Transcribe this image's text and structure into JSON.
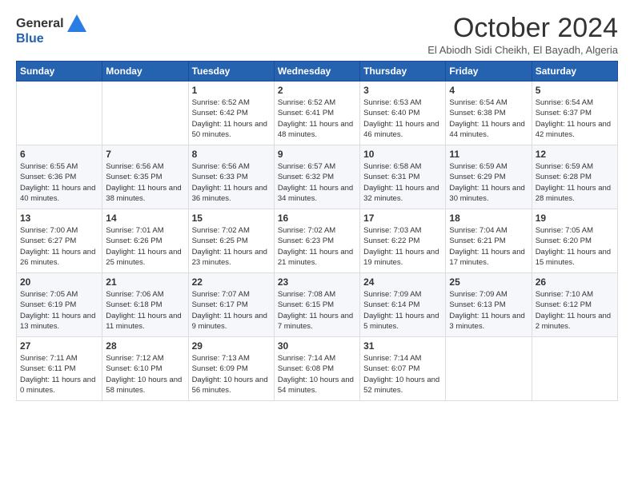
{
  "logo": {
    "general": "General",
    "blue": "Blue"
  },
  "title": "October 2024",
  "subtitle": "El Abiodh Sidi Cheikh, El Bayadh, Algeria",
  "days_of_week": [
    "Sunday",
    "Monday",
    "Tuesday",
    "Wednesday",
    "Thursday",
    "Friday",
    "Saturday"
  ],
  "weeks": [
    [
      {
        "day": "",
        "info": ""
      },
      {
        "day": "",
        "info": ""
      },
      {
        "day": "1",
        "info": "Sunrise: 6:52 AM\nSunset: 6:42 PM\nDaylight: 11 hours and 50 minutes."
      },
      {
        "day": "2",
        "info": "Sunrise: 6:52 AM\nSunset: 6:41 PM\nDaylight: 11 hours and 48 minutes."
      },
      {
        "day": "3",
        "info": "Sunrise: 6:53 AM\nSunset: 6:40 PM\nDaylight: 11 hours and 46 minutes."
      },
      {
        "day": "4",
        "info": "Sunrise: 6:54 AM\nSunset: 6:38 PM\nDaylight: 11 hours and 44 minutes."
      },
      {
        "day": "5",
        "info": "Sunrise: 6:54 AM\nSunset: 6:37 PM\nDaylight: 11 hours and 42 minutes."
      }
    ],
    [
      {
        "day": "6",
        "info": "Sunrise: 6:55 AM\nSunset: 6:36 PM\nDaylight: 11 hours and 40 minutes."
      },
      {
        "day": "7",
        "info": "Sunrise: 6:56 AM\nSunset: 6:35 PM\nDaylight: 11 hours and 38 minutes."
      },
      {
        "day": "8",
        "info": "Sunrise: 6:56 AM\nSunset: 6:33 PM\nDaylight: 11 hours and 36 minutes."
      },
      {
        "day": "9",
        "info": "Sunrise: 6:57 AM\nSunset: 6:32 PM\nDaylight: 11 hours and 34 minutes."
      },
      {
        "day": "10",
        "info": "Sunrise: 6:58 AM\nSunset: 6:31 PM\nDaylight: 11 hours and 32 minutes."
      },
      {
        "day": "11",
        "info": "Sunrise: 6:59 AM\nSunset: 6:29 PM\nDaylight: 11 hours and 30 minutes."
      },
      {
        "day": "12",
        "info": "Sunrise: 6:59 AM\nSunset: 6:28 PM\nDaylight: 11 hours and 28 minutes."
      }
    ],
    [
      {
        "day": "13",
        "info": "Sunrise: 7:00 AM\nSunset: 6:27 PM\nDaylight: 11 hours and 26 minutes."
      },
      {
        "day": "14",
        "info": "Sunrise: 7:01 AM\nSunset: 6:26 PM\nDaylight: 11 hours and 25 minutes."
      },
      {
        "day": "15",
        "info": "Sunrise: 7:02 AM\nSunset: 6:25 PM\nDaylight: 11 hours and 23 minutes."
      },
      {
        "day": "16",
        "info": "Sunrise: 7:02 AM\nSunset: 6:23 PM\nDaylight: 11 hours and 21 minutes."
      },
      {
        "day": "17",
        "info": "Sunrise: 7:03 AM\nSunset: 6:22 PM\nDaylight: 11 hours and 19 minutes."
      },
      {
        "day": "18",
        "info": "Sunrise: 7:04 AM\nSunset: 6:21 PM\nDaylight: 11 hours and 17 minutes."
      },
      {
        "day": "19",
        "info": "Sunrise: 7:05 AM\nSunset: 6:20 PM\nDaylight: 11 hours and 15 minutes."
      }
    ],
    [
      {
        "day": "20",
        "info": "Sunrise: 7:05 AM\nSunset: 6:19 PM\nDaylight: 11 hours and 13 minutes."
      },
      {
        "day": "21",
        "info": "Sunrise: 7:06 AM\nSunset: 6:18 PM\nDaylight: 11 hours and 11 minutes."
      },
      {
        "day": "22",
        "info": "Sunrise: 7:07 AM\nSunset: 6:17 PM\nDaylight: 11 hours and 9 minutes."
      },
      {
        "day": "23",
        "info": "Sunrise: 7:08 AM\nSunset: 6:15 PM\nDaylight: 11 hours and 7 minutes."
      },
      {
        "day": "24",
        "info": "Sunrise: 7:09 AM\nSunset: 6:14 PM\nDaylight: 11 hours and 5 minutes."
      },
      {
        "day": "25",
        "info": "Sunrise: 7:09 AM\nSunset: 6:13 PM\nDaylight: 11 hours and 3 minutes."
      },
      {
        "day": "26",
        "info": "Sunrise: 7:10 AM\nSunset: 6:12 PM\nDaylight: 11 hours and 2 minutes."
      }
    ],
    [
      {
        "day": "27",
        "info": "Sunrise: 7:11 AM\nSunset: 6:11 PM\nDaylight: 11 hours and 0 minutes."
      },
      {
        "day": "28",
        "info": "Sunrise: 7:12 AM\nSunset: 6:10 PM\nDaylight: 10 hours and 58 minutes."
      },
      {
        "day": "29",
        "info": "Sunrise: 7:13 AM\nSunset: 6:09 PM\nDaylight: 10 hours and 56 minutes."
      },
      {
        "day": "30",
        "info": "Sunrise: 7:14 AM\nSunset: 6:08 PM\nDaylight: 10 hours and 54 minutes."
      },
      {
        "day": "31",
        "info": "Sunrise: 7:14 AM\nSunset: 6:07 PM\nDaylight: 10 hours and 52 minutes."
      },
      {
        "day": "",
        "info": ""
      },
      {
        "day": "",
        "info": ""
      }
    ]
  ]
}
